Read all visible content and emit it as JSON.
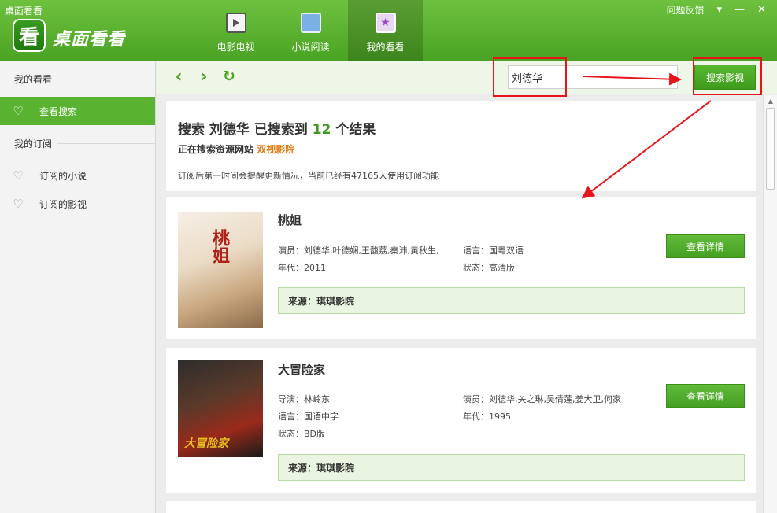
{
  "window": {
    "title": "桌面看看"
  },
  "app": {
    "logo_glyph": "看",
    "brand": "桌面看看"
  },
  "nav": [
    {
      "label": "电影电视",
      "icon": "film-icon"
    },
    {
      "label": "小说阅读",
      "icon": "book-icon"
    },
    {
      "label": "我的看看",
      "icon": "star-icon",
      "active": true
    }
  ],
  "topbar": {
    "feedback": "问题反馈",
    "menu_icon": "dropdown-menu-icon",
    "minimize_icon": "minimize-icon",
    "close_icon": "close-icon"
  },
  "sidebar": {
    "section_main": "我的看看",
    "items_main": [
      {
        "label": "查看搜索",
        "icon": "heart-icon",
        "active": true
      }
    ],
    "section_sub": "我的订阅",
    "items_sub": [
      {
        "label": "订阅的小说",
        "icon": "heart-icon"
      },
      {
        "label": "订阅的影视",
        "icon": "heart-icon"
      }
    ]
  },
  "toolbar": {
    "back_icon": "back-arrow-icon",
    "forward_icon": "forward-arrow-icon",
    "refresh_icon": "refresh-icon",
    "search_value": "刘德华",
    "search_button": "搜索影视"
  },
  "summary": {
    "prefix": "搜索 ",
    "keyword": "刘德华",
    "middle": " 已搜索到 ",
    "count": "12",
    "suffix": " 个结果",
    "searching_label": "正在搜索资源网站 ",
    "site": "双视影院",
    "note": "订阅后第一时间会提醒更新情况，当前已经有47165人使用订阅功能"
  },
  "results": [
    {
      "title": "桃姐",
      "fields": [
        "演员：刘德华,叶德娴,王馥荔,秦沛,黄秋生,",
        "年代：2011",
        "语言：国粤双语",
        "状态：高清版"
      ],
      "detail_button": "查看详情",
      "source": "来源：琪琪影院",
      "poster_text": "桃姐"
    },
    {
      "title": "大冒险家",
      "fields": [
        "导演：林岭东",
        "语言：国语中字",
        "状态：BD版",
        "演员：刘德华,关之琳,吴倩莲,姜大卫,何家",
        "年代：1995"
      ],
      "detail_button": "查看详情",
      "source": "来源：琪琪影院",
      "poster_text": "大冒险家"
    }
  ],
  "colors": {
    "brand_green": "#4aa323",
    "accent_orange": "#e07a10",
    "annotation_red": "#e8141b"
  }
}
